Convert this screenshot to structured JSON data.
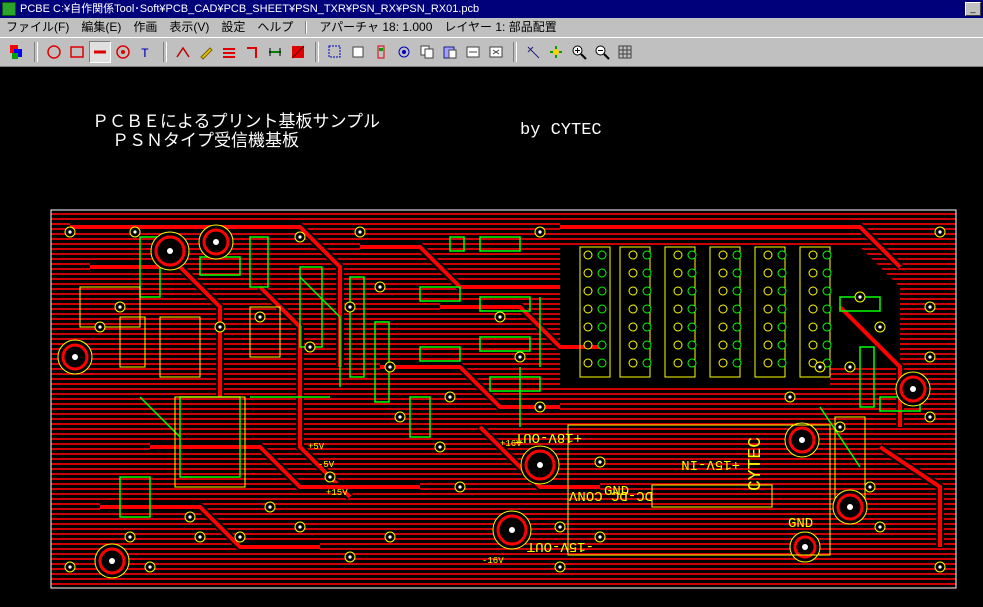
{
  "window": {
    "title": "PCBE  C:¥自作関係Tool･Soft¥PCB_CAD¥PCB_SHEET¥PSN_TXR¥PSN_RX¥PSN_RX01.pcb"
  },
  "menubar": {
    "items": [
      "ファイル(F)",
      "編集(E)",
      "作画",
      "表示(V)",
      "設定",
      "ヘルプ"
    ],
    "status_aperture": "アパーチャ 18: 1.000",
    "status_layer": "レイヤー 1: 部品配置"
  },
  "toolbar": {
    "icons": [
      "layers-icon",
      "circle-tool-icon",
      "rect-tool-icon",
      "line-tool-icon",
      "pad-tool-icon",
      "text-tool-icon",
      "pen-tool-icon",
      "pencil-tool-icon",
      "bus-tool-icon",
      "corner-tool-icon",
      "measure-tool-icon",
      "fill-tool-icon",
      "select-tool-icon",
      "move-tool-icon",
      "place-tool-icon",
      "via-tool-icon",
      "copy-icon",
      "paste-icon",
      "rotate-icon",
      "mirror-icon",
      "pin-icon",
      "snap-icon",
      "zoom-in-icon",
      "zoom-out-icon",
      "grid-icon"
    ],
    "pressed": "line-tool-icon"
  },
  "canvas": {
    "heading_line1": "ＰＣＢＥによるプリント基板サンプル",
    "heading_line2": "ＰＳＮタイプ受信機基板",
    "byline": "by CYTEC",
    "labels": {
      "plus15v": "+15V",
      "minus5v": "-5V",
      "plus5v": "+5V",
      "plus16v": "+16V",
      "minus16v": "-16V",
      "plus18v_out": "+18V-OUT",
      "plus15v_in": "+15V-IN",
      "minus15v_out": "-15V-OUT",
      "dc_dc_conv": "DC-DC CONV",
      "gnd": "GND",
      "cytec": "CYTEC"
    }
  },
  "colors": {
    "copper": "#ff0000",
    "silk": "#ffff00",
    "pad": "#00ff00",
    "trace": "#ff0000",
    "titlebar": "#00007b"
  }
}
